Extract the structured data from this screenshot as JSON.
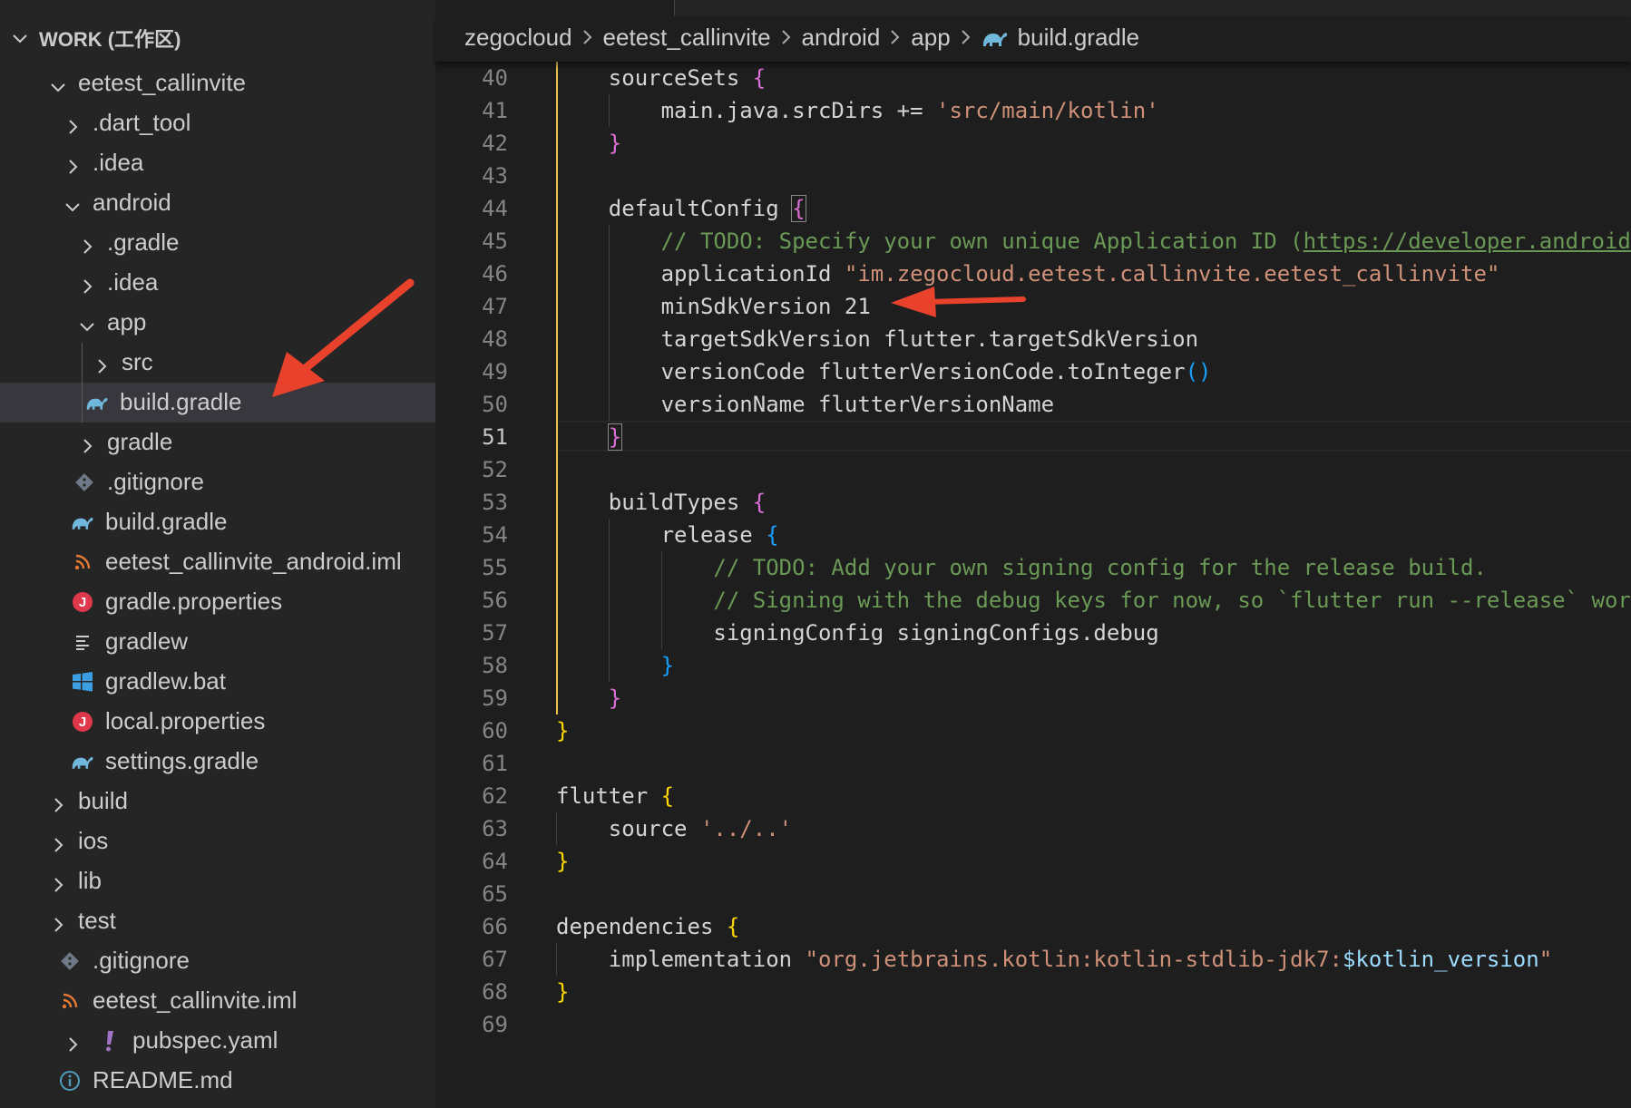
{
  "colors": {
    "background": "#1e1e1e",
    "sidebar_bg": "#252526",
    "selected_row": "#37373d",
    "string": "#ce9178",
    "comment": "#6a9955",
    "bracket_yellow": "#ffd700",
    "bracket_purple": "#da70d6",
    "bracket_blue": "#179fff",
    "variable": "#9cdcfe",
    "annotation_arrow": "#e8412c",
    "gradle_icon": "#6fb8dc",
    "properties_icon": "#e0384b",
    "xml_icon": "#e37933",
    "git_icon": "#6d7a87",
    "windows_icon": "#3c9ee0",
    "yaml_icon": "#a074c4",
    "info_icon": "#519aba"
  },
  "explorer": {
    "title": "WORK (工作区)",
    "items": [
      {
        "label": "eetest_callinvite",
        "icon": "chevron-down-icon",
        "kind": "folder",
        "expanded": true
      },
      {
        "label": ".dart_tool",
        "icon": "chevron-right-icon",
        "kind": "folder",
        "expanded": false
      },
      {
        "label": ".idea",
        "icon": "chevron-right-icon",
        "kind": "folder",
        "expanded": false
      },
      {
        "label": "android",
        "icon": "chevron-down-icon",
        "kind": "folder",
        "expanded": true
      },
      {
        "label": ".gradle",
        "icon": "chevron-right-icon",
        "kind": "folder",
        "expanded": false
      },
      {
        "label": ".idea",
        "icon": "chevron-right-icon",
        "kind": "folder",
        "expanded": false
      },
      {
        "label": "app",
        "icon": "chevron-down-icon",
        "kind": "folder",
        "expanded": true
      },
      {
        "label": "src",
        "icon": "chevron-right-icon",
        "kind": "folder",
        "expanded": false
      },
      {
        "label": "build.gradle",
        "icon": "gradle-elephant-icon",
        "kind": "file",
        "selected": true
      },
      {
        "label": "gradle",
        "icon": "chevron-right-icon",
        "kind": "folder",
        "expanded": false
      },
      {
        "label": ".gitignore",
        "icon": "git-icon",
        "kind": "file"
      },
      {
        "label": "build.gradle",
        "icon": "gradle-elephant-icon",
        "kind": "file"
      },
      {
        "label": "eetest_callinvite_android.iml",
        "icon": "rss-xml-icon",
        "kind": "file"
      },
      {
        "label": "gradle.properties",
        "icon": "properties-icon",
        "kind": "file"
      },
      {
        "label": "gradlew",
        "icon": "text-lines-icon",
        "kind": "file"
      },
      {
        "label": "gradlew.bat",
        "icon": "windows-icon",
        "kind": "file"
      },
      {
        "label": "local.properties",
        "icon": "properties-icon",
        "kind": "file"
      },
      {
        "label": "settings.gradle",
        "icon": "gradle-elephant-icon",
        "kind": "file"
      },
      {
        "label": "build",
        "icon": "chevron-right-icon",
        "kind": "folder",
        "expanded": false
      },
      {
        "label": "ios",
        "icon": "chevron-right-icon",
        "kind": "folder",
        "expanded": false
      },
      {
        "label": "lib",
        "icon": "chevron-right-icon",
        "kind": "folder",
        "expanded": false
      },
      {
        "label": "test",
        "icon": "chevron-right-icon",
        "kind": "folder",
        "expanded": false
      },
      {
        "label": ".gitignore",
        "icon": "git-icon",
        "kind": "file"
      },
      {
        "label": "eetest_callinvite.iml",
        "icon": "rss-xml-icon",
        "kind": "file"
      },
      {
        "label": "pubspec.yaml",
        "icon": "yaml-exclamation-icon",
        "kind": "file"
      },
      {
        "label": "README.md",
        "icon": "info-icon",
        "kind": "file"
      }
    ]
  },
  "breadcrumb": {
    "items": [
      "zegocloud",
      "eetest_callinvite",
      "android",
      "app",
      "build.gradle"
    ]
  },
  "editor": {
    "active_line": "51",
    "lines": [
      {
        "n": "40",
        "tokens": [
          [
            "    ",
            "ws"
          ],
          [
            "sourceSets ",
            "ident"
          ],
          [
            "{",
            "b2"
          ]
        ]
      },
      {
        "n": "41",
        "tokens": [
          [
            "        ",
            "ws"
          ],
          [
            "main.java.srcDirs += ",
            "ident"
          ],
          [
            "'src/main/kotlin'",
            "str"
          ]
        ]
      },
      {
        "n": "42",
        "tokens": [
          [
            "    ",
            "ws"
          ],
          [
            "}",
            "b2"
          ]
        ]
      },
      {
        "n": "43",
        "tokens": []
      },
      {
        "n": "44",
        "tokens": [
          [
            "    ",
            "ws"
          ],
          [
            "defaultConfig ",
            "ident"
          ],
          [
            "{",
            "b2m"
          ]
        ]
      },
      {
        "n": "45",
        "tokens": [
          [
            "        ",
            "ws"
          ],
          [
            "// TODO: Specify your own unique Application ID (",
            "cmt"
          ],
          [
            "https://developer.android",
            "url"
          ]
        ]
      },
      {
        "n": "46",
        "tokens": [
          [
            "        ",
            "ws"
          ],
          [
            "applicationId ",
            "ident"
          ],
          [
            "\"im.zegocloud.eetest.callinvite.eetest_callinvite\"",
            "str"
          ]
        ]
      },
      {
        "n": "47",
        "tokens": [
          [
            "        ",
            "ws"
          ],
          [
            "minSdkVersion 21",
            "ident"
          ]
        ]
      },
      {
        "n": "48",
        "tokens": [
          [
            "        ",
            "ws"
          ],
          [
            "targetSdkVersion flutter.targetSdkVersion",
            "ident"
          ]
        ]
      },
      {
        "n": "49",
        "tokens": [
          [
            "        ",
            "ws"
          ],
          [
            "versionCode flutterVersionCode.toInteger",
            "ident"
          ],
          [
            "()",
            "b3"
          ]
        ]
      },
      {
        "n": "50",
        "tokens": [
          [
            "        ",
            "ws"
          ],
          [
            "versionName flutterVersionName",
            "ident"
          ]
        ]
      },
      {
        "n": "51",
        "tokens": [
          [
            "    ",
            "ws"
          ],
          [
            "}",
            "b2m"
          ]
        ]
      },
      {
        "n": "52",
        "tokens": []
      },
      {
        "n": "53",
        "tokens": [
          [
            "    ",
            "ws"
          ],
          [
            "buildTypes ",
            "ident"
          ],
          [
            "{",
            "b2"
          ]
        ]
      },
      {
        "n": "54",
        "tokens": [
          [
            "        ",
            "ws"
          ],
          [
            "release ",
            "ident"
          ],
          [
            "{",
            "b3"
          ]
        ]
      },
      {
        "n": "55",
        "tokens": [
          [
            "            ",
            "ws"
          ],
          [
            "// TODO: Add your own signing config for the release build.",
            "cmt"
          ]
        ]
      },
      {
        "n": "56",
        "tokens": [
          [
            "            ",
            "ws"
          ],
          [
            "// Signing with the debug keys for now, so `flutter run --release` wor",
            "cmt"
          ]
        ]
      },
      {
        "n": "57",
        "tokens": [
          [
            "            ",
            "ws"
          ],
          [
            "signingConfig signingConfigs.debug",
            "ident"
          ]
        ]
      },
      {
        "n": "58",
        "tokens": [
          [
            "        ",
            "ws"
          ],
          [
            "}",
            "b3"
          ]
        ]
      },
      {
        "n": "59",
        "tokens": [
          [
            "    ",
            "ws"
          ],
          [
            "}",
            "b2"
          ]
        ]
      },
      {
        "n": "60",
        "tokens": [
          [
            "}",
            "b1"
          ]
        ]
      },
      {
        "n": "61",
        "tokens": []
      },
      {
        "n": "62",
        "tokens": [
          [
            "flutter ",
            "ident"
          ],
          [
            "{",
            "b1"
          ]
        ]
      },
      {
        "n": "63",
        "tokens": [
          [
            "    ",
            "ws"
          ],
          [
            "source ",
            "ident"
          ],
          [
            "'../..'",
            "str"
          ]
        ]
      },
      {
        "n": "64",
        "tokens": [
          [
            "}",
            "b1"
          ]
        ]
      },
      {
        "n": "65",
        "tokens": []
      },
      {
        "n": "66",
        "tokens": [
          [
            "dependencies ",
            "ident"
          ],
          [
            "{",
            "b1"
          ]
        ]
      },
      {
        "n": "67",
        "tokens": [
          [
            "    ",
            "ws"
          ],
          [
            "implementation ",
            "ident"
          ],
          [
            "\"org.jetbrains.kotlin:kotlin-stdlib-jdk7:",
            "str"
          ],
          [
            "$kotlin_version",
            "var"
          ],
          [
            "\"",
            "str"
          ]
        ]
      },
      {
        "n": "68",
        "tokens": [
          [
            "}",
            "b1"
          ]
        ]
      },
      {
        "n": "69",
        "tokens": []
      }
    ]
  }
}
